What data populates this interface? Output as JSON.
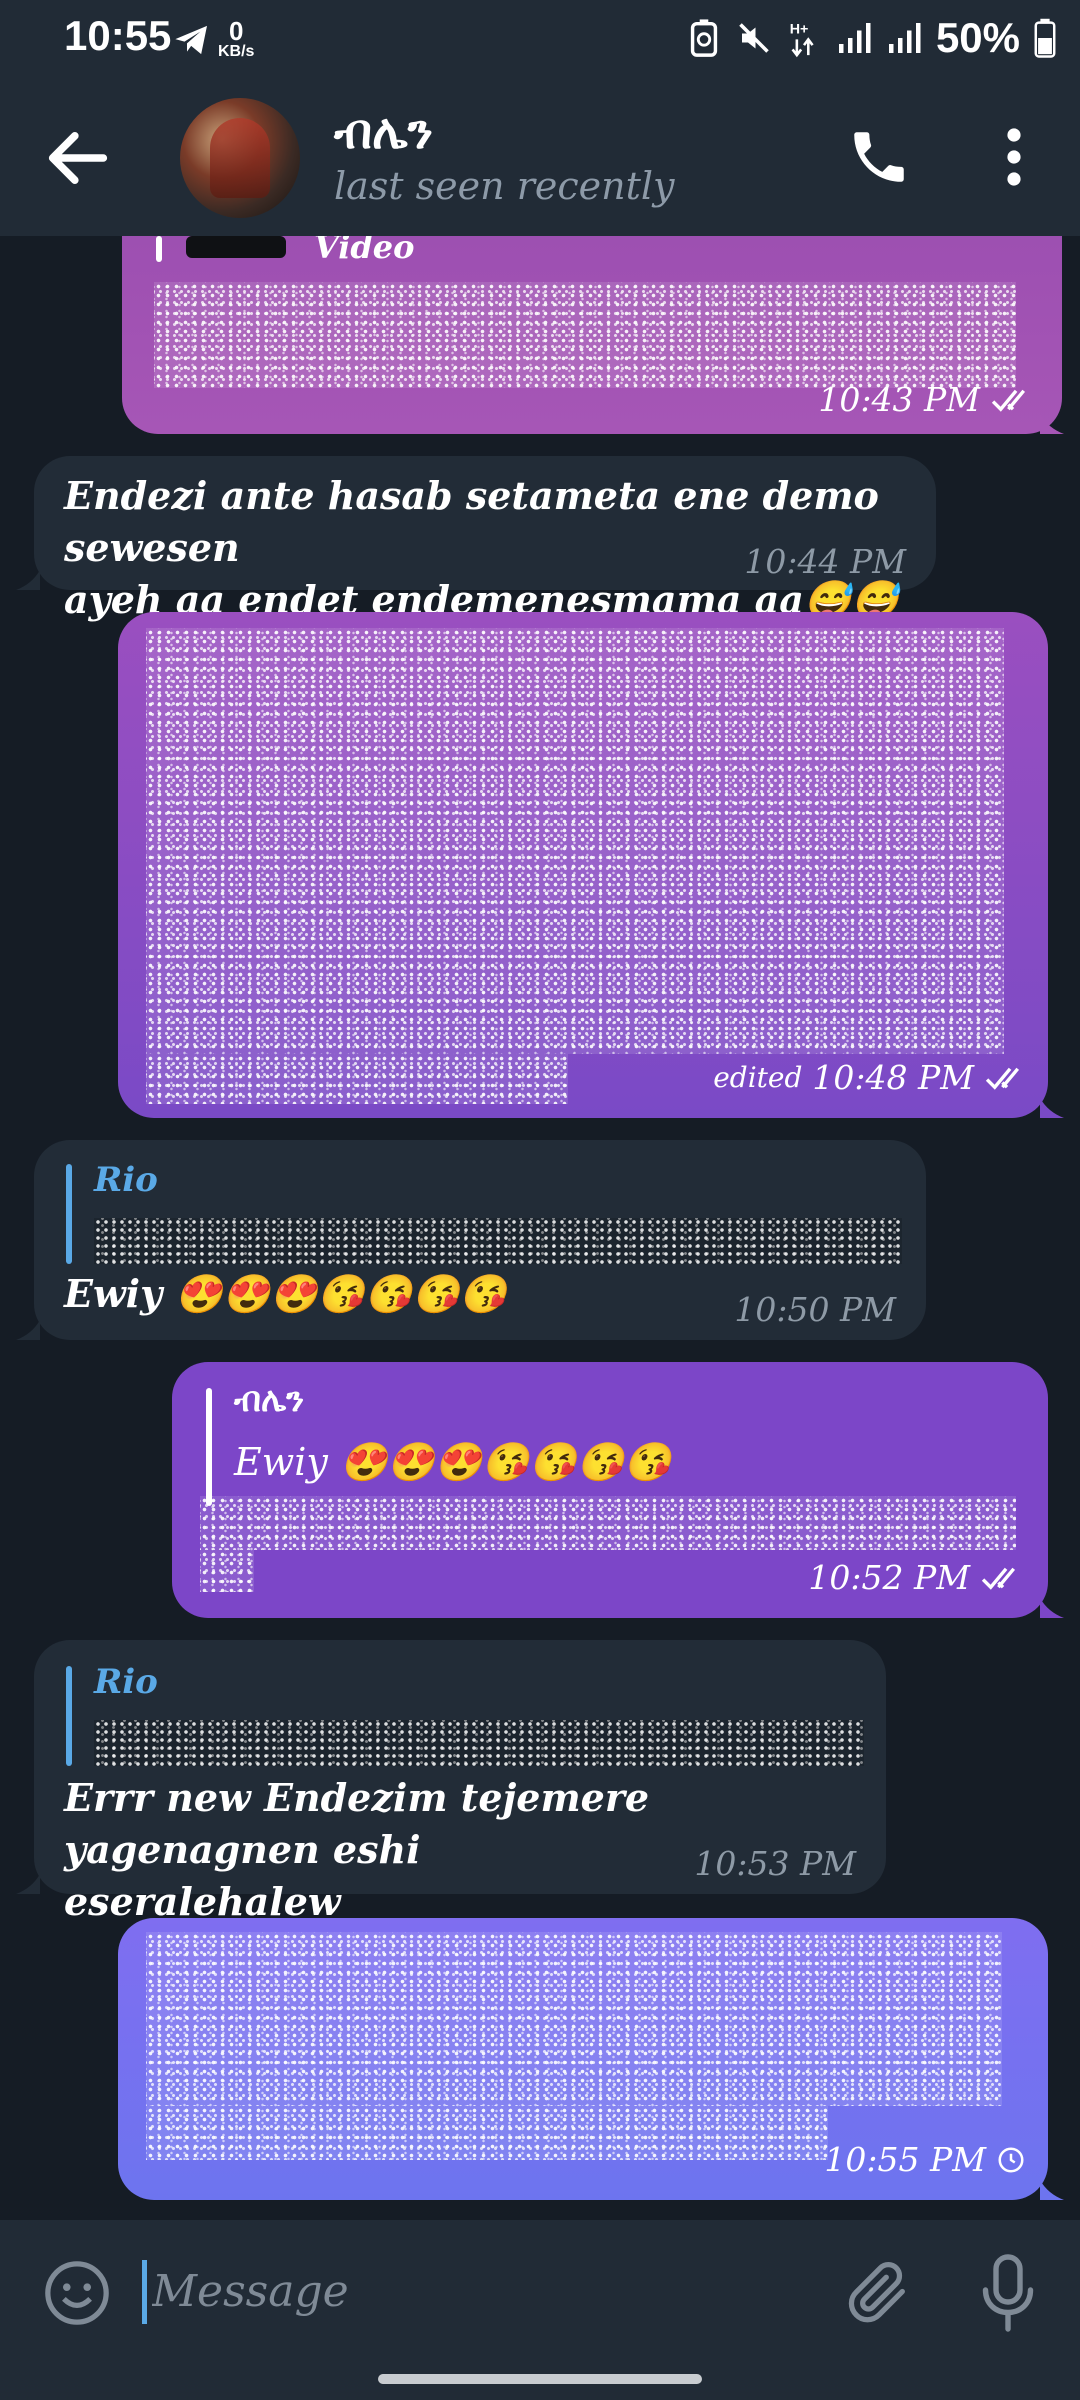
{
  "status_bar": {
    "time": "10:55",
    "net_speed_value": "0",
    "net_speed_unit": "KB/s",
    "network_type": "H+",
    "battery": "50%"
  },
  "header": {
    "name": "ብሌን",
    "status": "last seen recently"
  },
  "messages": [
    {
      "type": "outgoing",
      "media_label": "Video",
      "time": "10:43 PM",
      "read": true
    },
    {
      "type": "incoming",
      "text_line1": "Endezi ante hasab setameta ene demo sewesen",
      "text_line2": "ayeh aa endet endemenesmama aa😅😅",
      "time": "10:44 PM"
    },
    {
      "type": "outgoing",
      "edited_label": "edited",
      "time": "10:48 PM",
      "read": true
    },
    {
      "type": "incoming",
      "reply_name": "Rio",
      "text": "Ewiy 😍😍😍😘😘😘😘",
      "time": "10:50 PM"
    },
    {
      "type": "outgoing",
      "reply_name": "ብሌን",
      "reply_text": "Ewiy 😍😍😍😘😘😘😘",
      "time": "10:52 PM",
      "read": true
    },
    {
      "type": "incoming",
      "reply_name": "Rio",
      "text_line1": "Errr new  Endezim tejemere yagenagnen eshi",
      "text_line2": "eseralehalew",
      "time": "10:53 PM"
    },
    {
      "type": "outgoing",
      "time": "10:55 PM",
      "pending": true
    }
  ],
  "composer": {
    "placeholder": "Message"
  },
  "colors": {
    "background": "#151c25",
    "header": "#212b36",
    "incoming_bubble": "#222c37",
    "reply_accent": "#5aa9e6",
    "outgoing_purple": "#9b4eb0",
    "outgoing_violet": "#7c46c8",
    "outgoing_indigo": "#6d74ef"
  }
}
